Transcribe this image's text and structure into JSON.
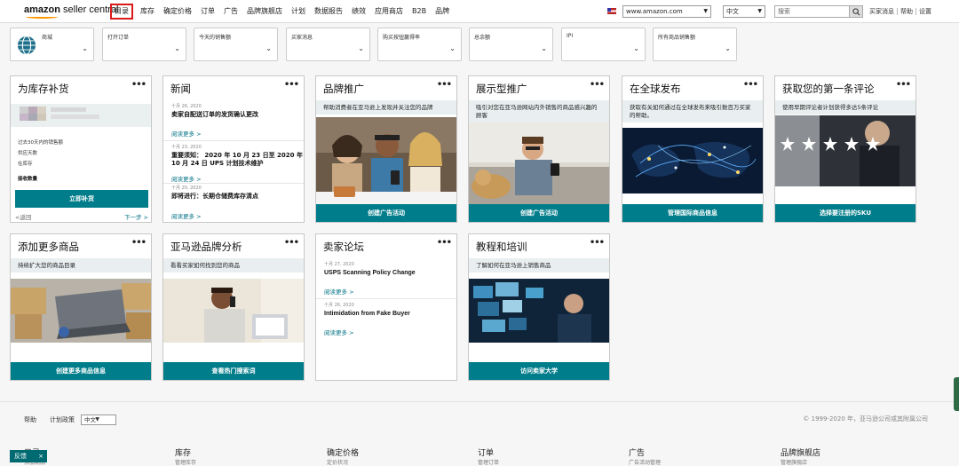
{
  "header": {
    "logo_main": "amazon",
    "logo_sub": " seller central",
    "nav": [
      "目录",
      "库存",
      "确定价格",
      "订单",
      "广告",
      "品牌旗舰店",
      "计划",
      "数据报告",
      "绩效",
      "应用商店",
      "B2B",
      "品牌"
    ],
    "marketplace": "www.amazon.com",
    "language": "中文",
    "search_placeholder": "搜索",
    "links": [
      "买家消息",
      "帮助",
      "设置"
    ]
  },
  "metrics": [
    "商城",
    "打开订单",
    "今天的销售额",
    "买家消息",
    "购买按钮赢得率",
    "总余额",
    "IPI",
    "所有商品销售额"
  ],
  "cards": {
    "restock": {
      "title": "为库存补货",
      "rows": [
        "过去30天内的销售额",
        "供应天数",
        "在库存"
      ],
      "inventory_label": "接收数量",
      "button": "立即补货",
      "prev": "<返回",
      "next": "下一步 >"
    },
    "news": {
      "title": "新闻",
      "items": [
        {
          "date": "十月 26, 2020",
          "title": "卖家自配送订单的发货确认更改",
          "more": "阅读更多 >"
        },
        {
          "date": "十月 23, 2020",
          "title": "重要须知： 2020 年 10 月 23 日至 2020 年 10 月 24 日 UPS 计划技术维护",
          "more": "阅读更多 >"
        },
        {
          "date": "十月 20, 2020",
          "title": "即将进行：长期仓储费库存清点",
          "more": "阅读更多 >"
        }
      ]
    },
    "brand_promo": {
      "title": "品牌推广",
      "desc": "帮助消费者在亚马逊上发现并关注您的品牌",
      "action": "创建广告活动"
    },
    "display_ads": {
      "title": "展示型推广",
      "desc": "吸引对您在亚马逊网站内外销售的商品感兴趣的顾客",
      "action": "创建广告活动"
    },
    "global": {
      "title": "在全球发布",
      "desc": "获取有关如何通过在全球发布来吸引数百万买家的帮助。",
      "action": "管理国际商品信息"
    },
    "first_review": {
      "title": "获取您的第一条评论",
      "desc": "使用早期评论者计划获得多达5条评论",
      "action": "选择要注册的SKU"
    },
    "add_products": {
      "title": "添加更多商品",
      "desc": "持续扩大您的商品目录",
      "action": "创建更多商品信息"
    },
    "brand_analytics": {
      "title": "亚马逊品牌分析",
      "desc": "看看买家如何找到您的商品",
      "action": "查看热门搜索词"
    },
    "forums": {
      "title": "卖家论坛",
      "items": [
        {
          "date": "十月 27, 2020",
          "title": "USPS Scanning Policy Change",
          "more": "阅读更多 >"
        },
        {
          "date": "十月 26, 2020",
          "title": "Intimidation from Fake Buyer",
          "more": "阅读更多 >"
        }
      ]
    },
    "training": {
      "title": "教程和培训",
      "desc": "了解如何在亚马逊上销售商品",
      "action": "访问卖家大学"
    }
  },
  "footer": {
    "links": [
      "帮助",
      "计划政策"
    ],
    "language": "中文",
    "copyright": "© 1999-2020 年，亚马逊公司或其附属公司",
    "columns": [
      "目录",
      "库存",
      "确定价格",
      "订单",
      "广告",
      "品牌旗舰店"
    ],
    "column_subs": [
      "添加商品",
      "管理库存",
      "定价状况",
      "管理订单",
      "广告活动管理",
      "管理旗舰店"
    ],
    "feedback": "反馈",
    "feedback_close": "×"
  },
  "colors": {
    "accent": "#007d8a",
    "link": "#007185",
    "highlight": "#d91a1a",
    "logo_smile": "#ff9900"
  }
}
